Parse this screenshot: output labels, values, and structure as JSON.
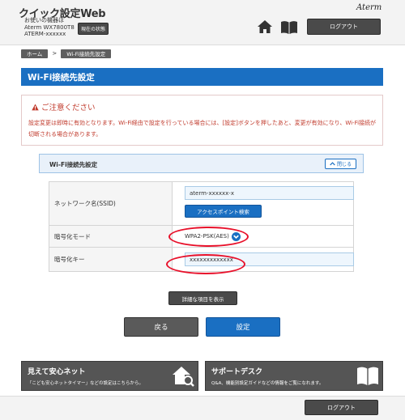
{
  "header": {
    "app_title": "クイック設定Web",
    "device_label": "お使いの機器は",
    "device_model": "Aterm WX7800T8",
    "device_name": "ATERM-xxxxxx",
    "status_button": "現在の状態",
    "brand": "Aterm",
    "logout_label": "ログアウト"
  },
  "breadcrumb": {
    "home": "ホーム",
    "separator": ">",
    "current": "Wi-Fi接続先設定"
  },
  "page": {
    "title": "Wi-Fi接続先設定"
  },
  "caution": {
    "title": "ご注意ください",
    "text": "設定変更は即時に有効となります。Wi-Fi経由で設定を行っている場合には、[設定]ボタンを押したあと、変更が有効になり、Wi-Fi接続が切断される場合があります。"
  },
  "panel": {
    "title": "Wi-Fi接続先設定",
    "collapse_label": "閉じる",
    "ssid_label": "ネットワーク名(SSID)",
    "ssid_value": "aterm-xxxxxx-x",
    "ap_search_label": "アクセスポイント検索",
    "encryption_label": "暗号化モード",
    "encryption_value": "WPA2-PSK(AES)",
    "key_label": "暗号化キー",
    "key_value": "xxxxxxxxxxxxx"
  },
  "actions": {
    "detail_label": "詳細な項目を表示",
    "back_label": "戻る",
    "set_label": "設定"
  },
  "banners": {
    "left_title": "見えて安心ネット",
    "left_desc": "「こども安心ネットタイマー」などの設定はこちらから。",
    "right_title": "サポートデスク",
    "right_desc": "Q&A、機能別設定ガイドなどの情報をご覧になれます。"
  },
  "footer": {
    "logout_label": "ログアウト"
  },
  "colors": {
    "accent": "#1a6fc2",
    "dark_button": "#4a4a4a",
    "caution": "#c0392b",
    "highlight_oval": "#e8102a"
  }
}
